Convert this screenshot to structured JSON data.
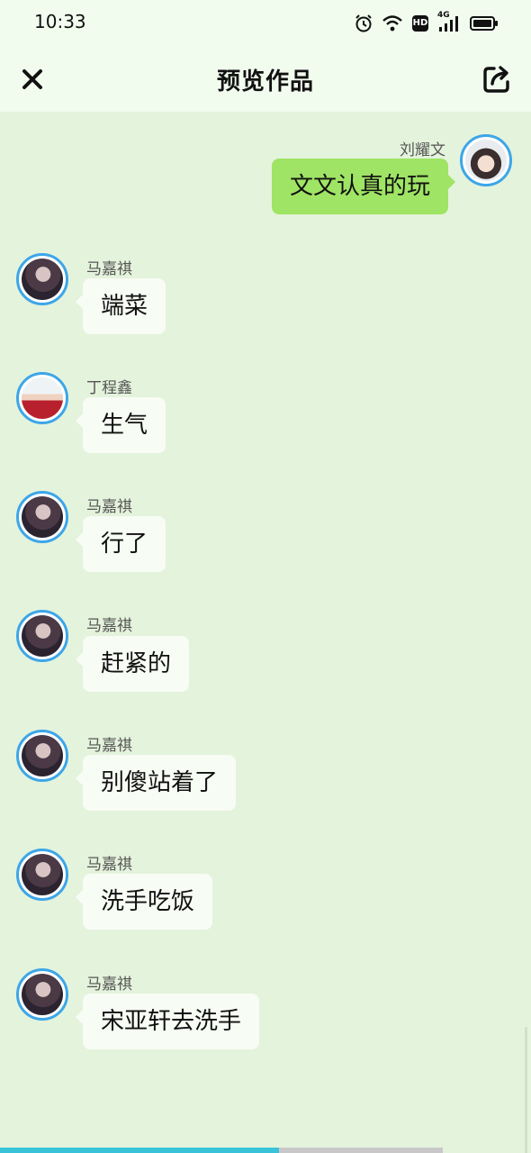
{
  "status_bar": {
    "time": "10:33",
    "icons": [
      "alarm-icon",
      "wifi-icon",
      "hd-icon",
      "4g-signal-icon",
      "battery-icon"
    ],
    "hd_label": "HD",
    "network_label": "4G"
  },
  "header": {
    "title": "预览作品",
    "close_icon": "close-icon",
    "share_icon": "share-icon"
  },
  "messages": [
    {
      "side": "right",
      "sender": "刘耀文",
      "text": "文文认真的玩"
    },
    {
      "side": "left",
      "sender": "马嘉祺",
      "text": "端菜"
    },
    {
      "side": "left",
      "sender": "丁程鑫",
      "text": "生气"
    },
    {
      "side": "left",
      "sender": "马嘉祺",
      "text": "行了"
    },
    {
      "side": "left",
      "sender": "马嘉祺",
      "text": "赶紧的"
    },
    {
      "side": "left",
      "sender": "马嘉祺",
      "text": "别傻站着了"
    },
    {
      "side": "left",
      "sender": "马嘉祺",
      "text": "洗手吃饭"
    },
    {
      "side": "left",
      "sender": "马嘉祺",
      "text": "宋亚轩去洗手"
    }
  ],
  "progress": {
    "fraction": 0.63
  },
  "colors": {
    "background": "#e4f3dc",
    "header": "#f1fbee",
    "bubble_left": "#f7fcf4",
    "bubble_right": "#9fe464",
    "avatar_ring": "#3da6e8",
    "progress": "#39c3d8"
  }
}
